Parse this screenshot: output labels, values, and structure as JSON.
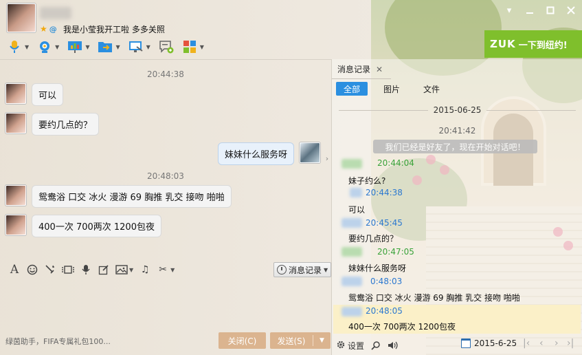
{
  "header": {
    "signature": "我是小莹我开工啦 多多关照"
  },
  "ad": {
    "brand": "ZUK",
    "slogan": "一下到纽约!"
  },
  "chat": {
    "messages": [
      {
        "time": "20:44:38"
      },
      {
        "side": "left",
        "text": "可以"
      },
      {
        "side": "left",
        "text": "要约几点的？"
      },
      {
        "side": "right",
        "text": "妹妹什么服务呀"
      },
      {
        "time": "20:48:03"
      },
      {
        "side": "left",
        "text": "鸳鸯浴  口交 冰火 漫游 69 胸推 乳交 接吻 啪啪"
      },
      {
        "side": "left",
        "text": "400一次 700两次 1200包夜"
      }
    ]
  },
  "input": {
    "history_label": "消息记录",
    "bottom_hint": "绿茵助手，FIFA专属礼包100...",
    "close_label": "关闭(C)",
    "send_label": "发送(S)"
  },
  "panel": {
    "tab_label": "消息记录",
    "filters": [
      "全部",
      "图片",
      "文件"
    ],
    "date": "2015-06-25",
    "first_time": "20:41:42",
    "system_message": "我们已经是好友了，现在开始对话吧！",
    "records": [
      {
        "time": "20:44:04",
        "text": "妹子约么?",
        "color": "#3aa33a"
      },
      {
        "time": "20:44:38",
        "text": "可以",
        "color": "#2b78d0"
      },
      {
        "time": "20:45:45",
        "text": "要约几点的？",
        "color": "#2b78d0"
      },
      {
        "time": "20:47:05",
        "text": "妹妹什么服务呀",
        "color": "#3aa33a"
      },
      {
        "time": "0:48:03",
        "text": "鸳鸯浴  口交 冰火 漫游 69 胸推 乳交 接吻 啪啪",
        "color": "#2b78d0"
      },
      {
        "time": "20:48:05",
        "text": "400一次 700两次 1200包夜",
        "color": "#2b78d0"
      }
    ],
    "settings_label": "设置",
    "date_picker": "2015-6-25"
  }
}
